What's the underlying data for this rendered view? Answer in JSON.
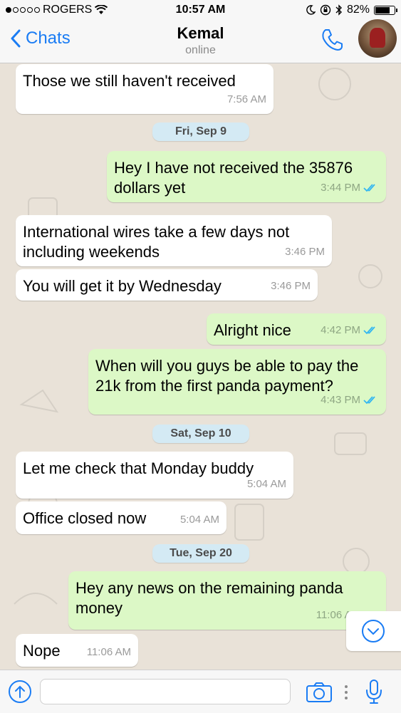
{
  "status_bar": {
    "carrier": "ROGERS",
    "time": "10:57 AM",
    "battery": "82%",
    "battery_level": 0.82
  },
  "header": {
    "back_label": "Chats",
    "contact_name": "Kemal",
    "contact_status": "online"
  },
  "messages": [
    {
      "dir": "in",
      "text": "Those we still haven't received",
      "time": "7:56 AM"
    },
    {
      "dir": "date",
      "text": "Fri, Sep 9"
    },
    {
      "dir": "out",
      "text": "Hey I have not received the 35876\ndollars yet",
      "time": "3:44 PM",
      "read": true
    },
    {
      "dir": "in",
      "text": "International wires take a few days not\nincluding weekends",
      "time": "3:46 PM"
    },
    {
      "dir": "in",
      "text": "You will get it by Wednesday",
      "time": "3:46 PM"
    },
    {
      "dir": "out",
      "text": "Alright nice",
      "time": "4:42 PM",
      "read": true
    },
    {
      "dir": "out",
      "text": "When will you guys be able to pay the\n21k from the first panda payment?",
      "time": "4:43 PM",
      "read": true
    },
    {
      "dir": "date",
      "text": "Sat, Sep 10"
    },
    {
      "dir": "in",
      "text": "Let me check that Monday buddy",
      "time": "5:04 AM"
    },
    {
      "dir": "in",
      "text": "Office closed now",
      "time": "5:04 AM"
    },
    {
      "dir": "date",
      "text": "Tue, Sep 20"
    },
    {
      "dir": "out",
      "text": "Hey any news on the remaining panda\nmoney",
      "time": "11:06 AM",
      "read": true
    },
    {
      "dir": "in",
      "text": "Nope",
      "time": "11:06 AM"
    }
  ],
  "input": {
    "placeholder": ""
  },
  "colors": {
    "accent": "#1a7cf4",
    "outgoing_bubble": "#dcf8c6",
    "incoming_bubble": "#ffffff",
    "read_ticks": "#34b7f1",
    "chat_background": "#e9e2d8"
  },
  "icons": {
    "status": [
      "wifi-icon",
      "moon-icon",
      "orientation-lock-icon",
      "bluetooth-icon",
      "battery-icon"
    ],
    "header": [
      "chevron-left-icon",
      "phone-icon",
      "avatar"
    ],
    "input_bar": [
      "share-icon",
      "camera-icon",
      "more-icon",
      "microphone-icon"
    ],
    "chat": [
      "scroll-down-icon",
      "double-check-icon"
    ]
  }
}
